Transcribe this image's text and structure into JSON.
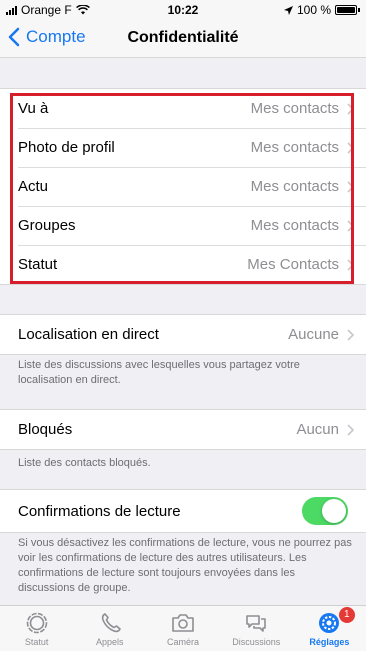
{
  "status_bar": {
    "carrier": "Orange F",
    "time": "10:22",
    "battery": "100 %"
  },
  "nav": {
    "back_label": "Compte",
    "title": "Confidentialité"
  },
  "privacy_items": [
    {
      "label": "Vu à",
      "value": "Mes contacts"
    },
    {
      "label": "Photo de profil",
      "value": "Mes contacts"
    },
    {
      "label": "Actu",
      "value": "Mes contacts"
    },
    {
      "label": "Groupes",
      "value": "Mes contacts"
    },
    {
      "label": "Statut",
      "value": "Mes Contacts"
    }
  ],
  "live_location": {
    "label": "Localisation en direct",
    "value": "Aucune",
    "note": "Liste des discussions avec lesquelles vous partagez votre localisation en direct."
  },
  "blocked": {
    "label": "Bloqués",
    "value": "Aucun",
    "note": "Liste des contacts bloqués."
  },
  "read_receipts": {
    "label": "Confirmations de lecture",
    "enabled": true,
    "note": "Si vous désactivez les confirmations de lecture, vous ne pourrez pas voir les confirmations de lecture des autres utilisateurs. Les confirmations de lecture sont toujours envoyées dans les discussions de groupe."
  },
  "tabs": [
    {
      "label": "Statut",
      "icon": "status-icon"
    },
    {
      "label": "Appels",
      "icon": "phone-icon"
    },
    {
      "label": "Caméra",
      "icon": "camera-icon"
    },
    {
      "label": "Discussions",
      "icon": "chats-icon"
    },
    {
      "label": "Réglages",
      "icon": "settings-icon",
      "active": true,
      "badge": "1"
    }
  ],
  "colors": {
    "accent": "#1778f2",
    "toggle_on": "#4cd964",
    "highlight": "#d71f2c",
    "badge": "#e53935"
  }
}
